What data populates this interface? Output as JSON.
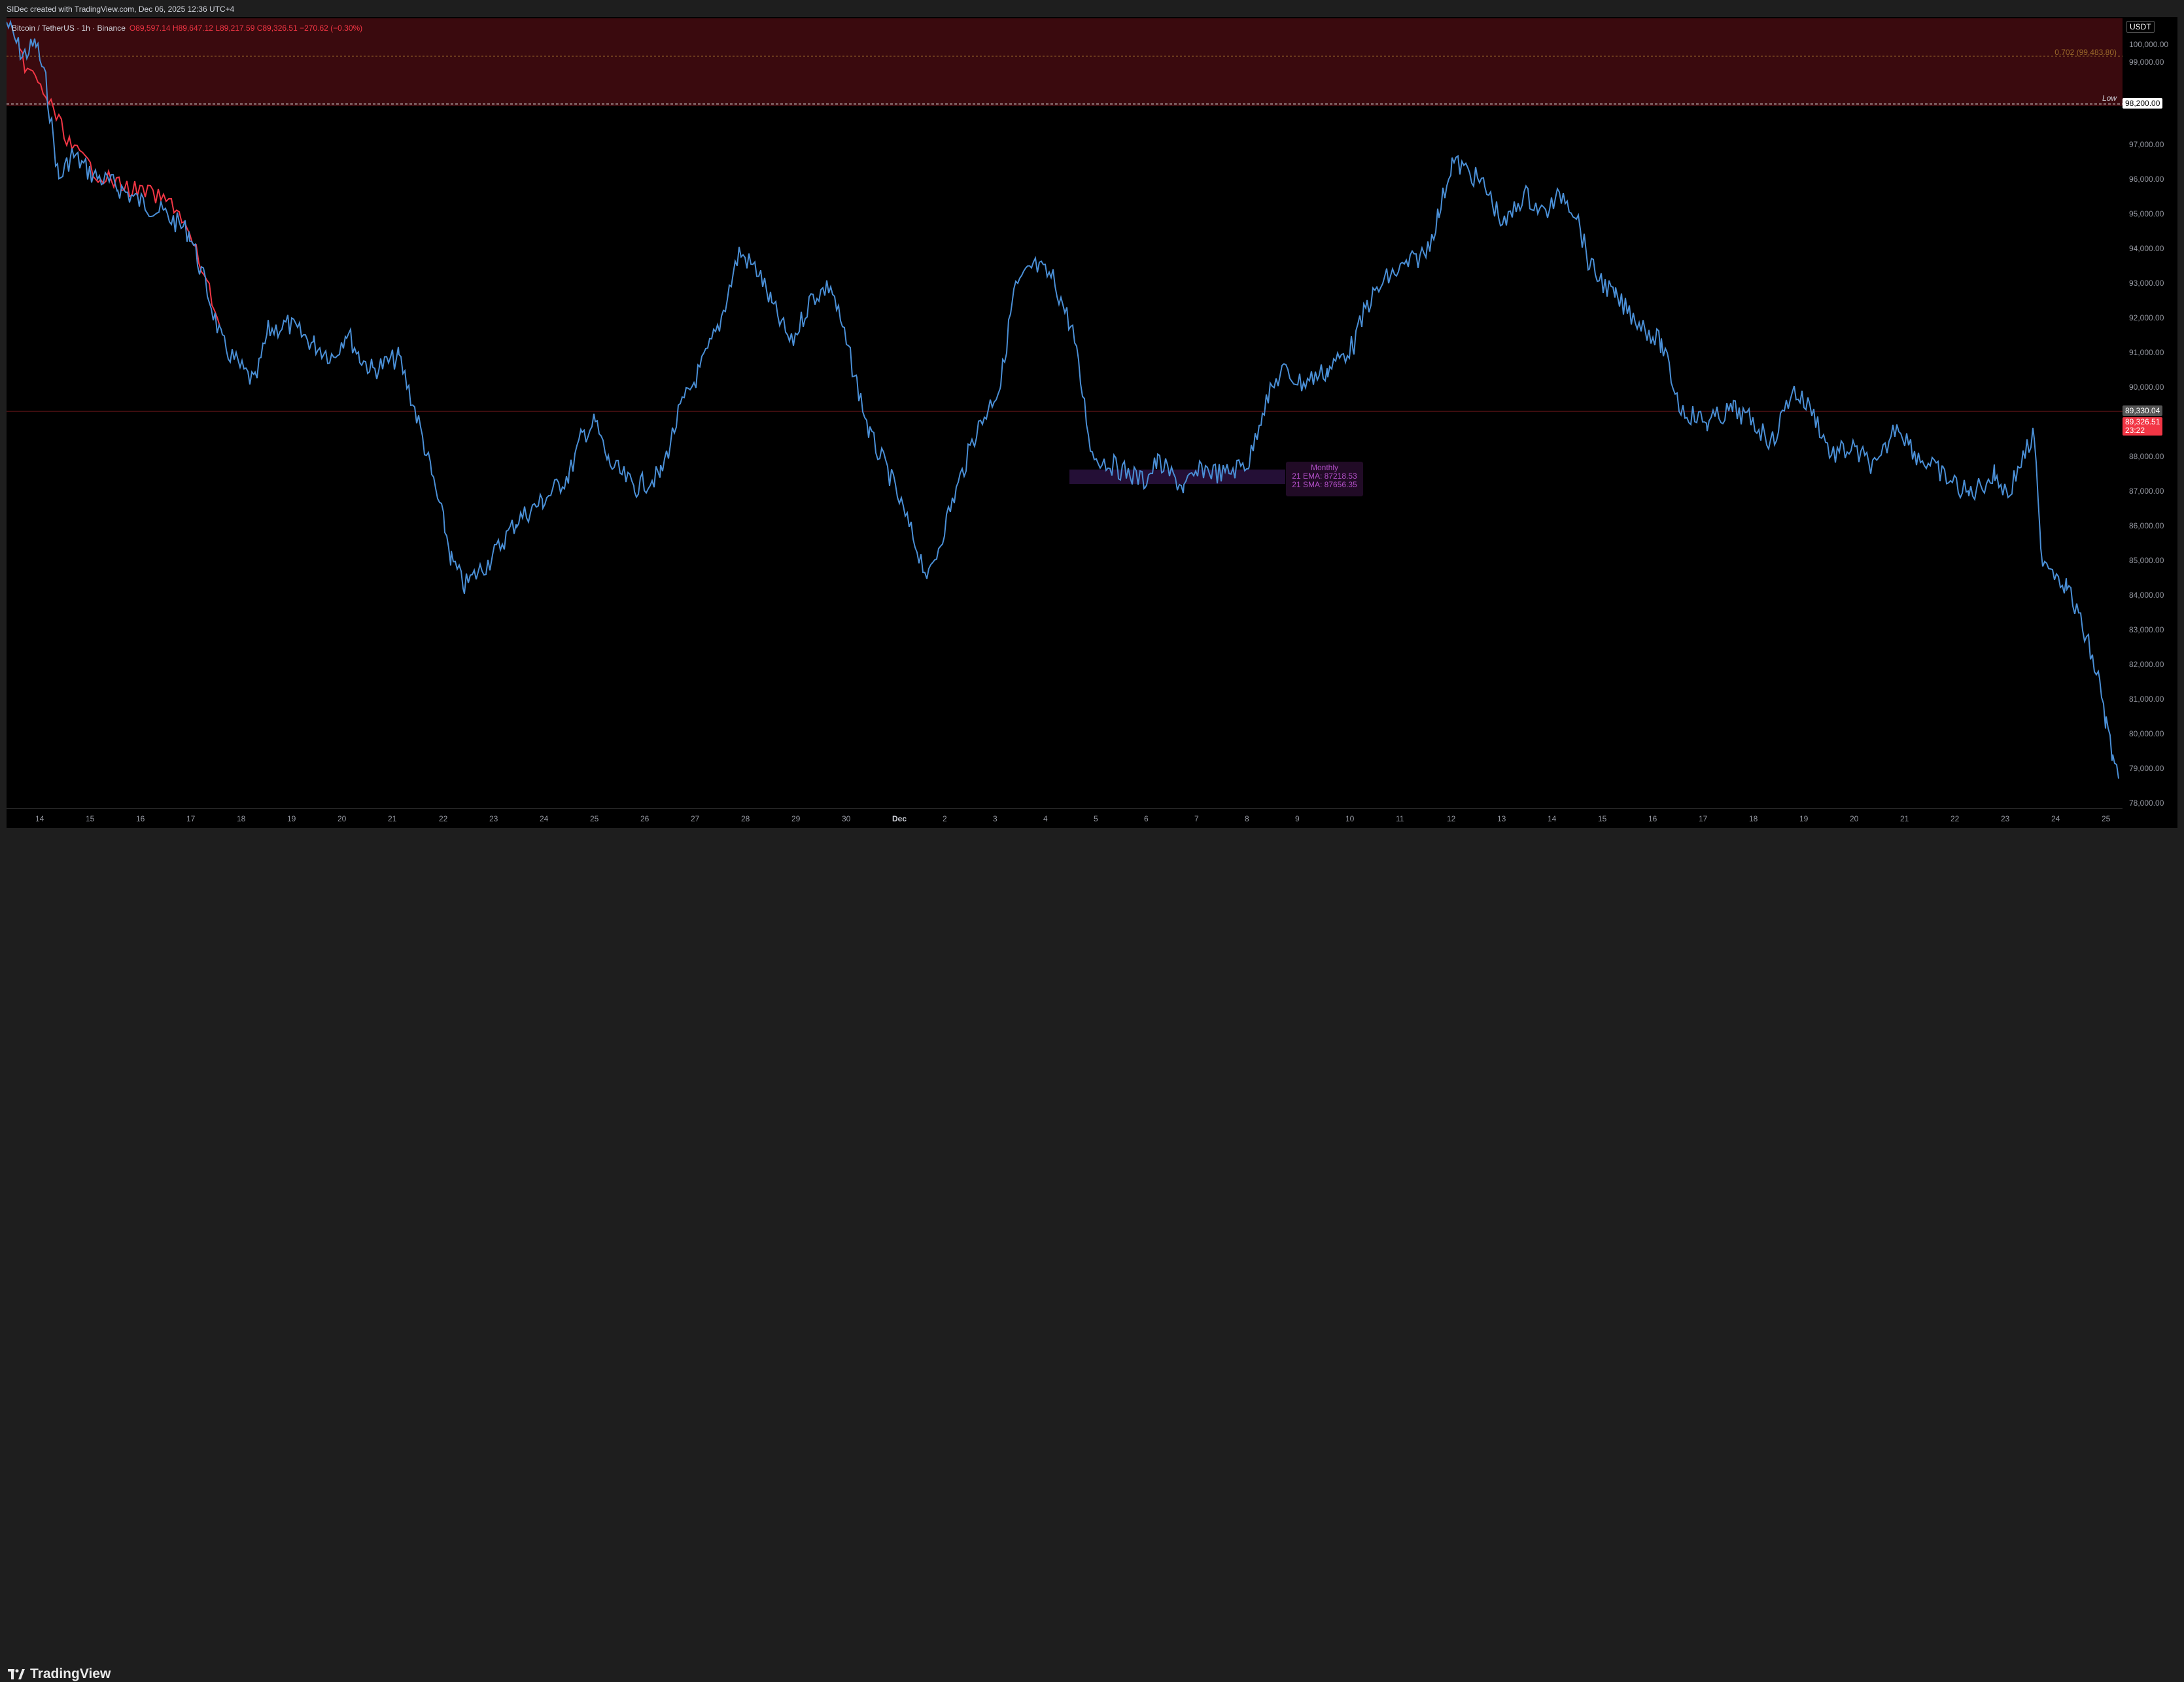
{
  "header": {
    "credit": "SIDec created with TradingView.com, Dec 06, 2025 12:36 UTC+4"
  },
  "legend": {
    "symbol": "Bitcoin / TetherUS · 1h · Binance",
    "ohlc": "O89,597.14 H89,647.12 L89,217.59 C89,326.51 −270.62 (−0.30%)"
  },
  "price_axis": {
    "currency": "USDT",
    "labels": [
      "100,000.00",
      "99,000.00",
      "97,000.00",
      "96,000.00",
      "95,000.00",
      "94,000.00",
      "93,000.00",
      "92,000.00",
      "91,000.00",
      "90,000.00",
      "88,000.00",
      "87,000.00",
      "86,000.00",
      "85,000.00",
      "84,000.00",
      "83,000.00",
      "82,000.00",
      "81,000.00",
      "80,000.00",
      "79,000.00",
      "78,000.00"
    ],
    "low_level": "98,200.00",
    "last_high": "89,330.04",
    "last_close": "89,326.51",
    "countdown": "23:22"
  },
  "time_axis": {
    "labels": [
      "14",
      "15",
      "16",
      "17",
      "18",
      "19",
      "20",
      "21",
      "22",
      "23",
      "24",
      "25",
      "26",
      "27",
      "28",
      "29",
      "30",
      "Dec",
      "2",
      "3",
      "4",
      "5",
      "6",
      "7",
      "8",
      "9",
      "10",
      "11",
      "12",
      "13",
      "14",
      "15",
      "16",
      "17",
      "18",
      "19",
      "20",
      "21",
      "22",
      "23",
      "24",
      "25"
    ]
  },
  "annotations": {
    "fib": "0.702 (99,483.80)",
    "low_label": "Low",
    "indicator_title": "Monthly",
    "ema": "21 EMA: 87218.53",
    "sma": "21 SMA: 87656.35"
  },
  "footer": {
    "brand": "TradingView"
  },
  "colors": {
    "price_line": "#4a8fd6",
    "down_candle": "#f23645",
    "up_candle": "#26a69a",
    "zone": "#3a0a0e",
    "indicator": "#b24fc7"
  }
}
